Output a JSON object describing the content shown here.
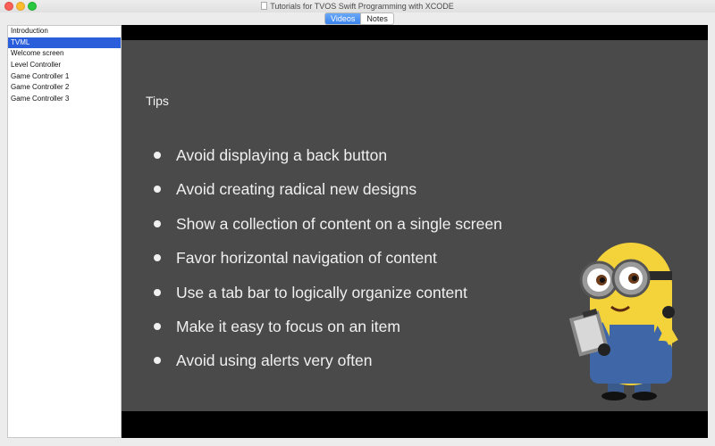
{
  "window": {
    "title": "Tutorials for TVOS Swift Programming with XCODE"
  },
  "segmented": {
    "tabs": [
      {
        "label": "Videos",
        "active": true
      },
      {
        "label": "Notes",
        "active": false
      }
    ]
  },
  "sidebar": {
    "items": [
      {
        "label": "Introduction",
        "selected": false
      },
      {
        "label": "TVML",
        "selected": true
      },
      {
        "label": "Welcome screen",
        "selected": false
      },
      {
        "label": "Level Controller",
        "selected": false
      },
      {
        "label": "Game Controller 1",
        "selected": false
      },
      {
        "label": "Game Controller 2",
        "selected": false
      },
      {
        "label": "Game Controller 3",
        "selected": false
      }
    ]
  },
  "slide": {
    "title": "Tips",
    "bullets": [
      "Avoid displaying a back button",
      "Avoid creating radical new designs",
      "Show a collection of content on a single screen",
      "Favor horizontal navigation of content",
      "Use a tab bar to logically organize content",
      "Make it easy to focus on an item",
      "Avoid using alerts very often"
    ]
  },
  "colors": {
    "accent": "#3a83ef",
    "selection": "#2b5edb",
    "slide_background": "#4b4a4a",
    "letterbox": "#000000"
  },
  "icons": [
    "document-icon",
    "close-window-icon",
    "minimize-window-icon",
    "zoom-window-icon"
  ]
}
